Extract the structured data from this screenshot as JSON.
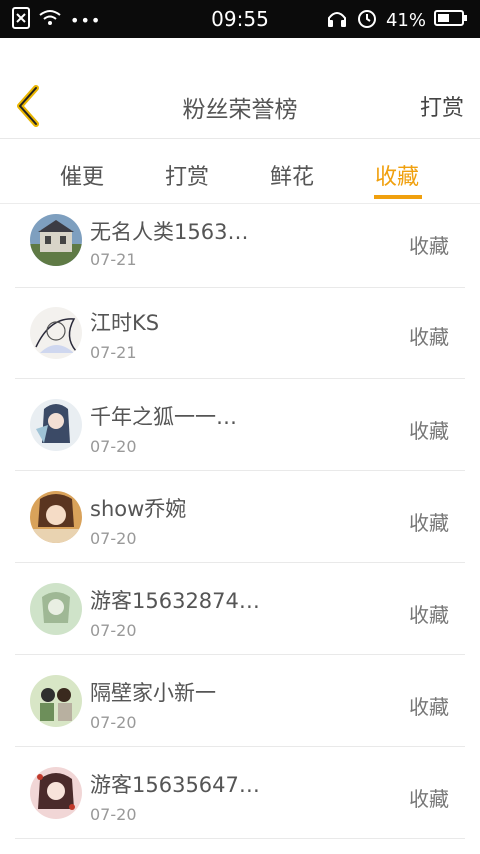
{
  "status_bar": {
    "time": "09:55",
    "battery": "41%"
  },
  "header": {
    "title": "粉丝荣誉榜",
    "right_action": "打赏"
  },
  "tabs": [
    {
      "label": "催更"
    },
    {
      "label": "打赏"
    },
    {
      "label": "鲜花"
    },
    {
      "label": "收藏",
      "active": true
    }
  ],
  "colors": {
    "accent": "#f0a00e"
  },
  "rows": [
    {
      "name": "无名人类1563…",
      "date": "07-21",
      "action": "收藏"
    },
    {
      "name": "江时KS",
      "date": "07-21",
      "action": "收藏"
    },
    {
      "name": "千年之狐一一…",
      "date": "07-20",
      "action": "收藏"
    },
    {
      "name": "show乔婉",
      "date": "07-20",
      "action": "收藏"
    },
    {
      "name": "游客15632874…",
      "date": "07-20",
      "action": "收藏"
    },
    {
      "name": "隔壁家小新一",
      "date": "07-20",
      "action": "收藏"
    },
    {
      "name": "游客15635647…",
      "date": "07-20",
      "action": "收藏"
    }
  ]
}
